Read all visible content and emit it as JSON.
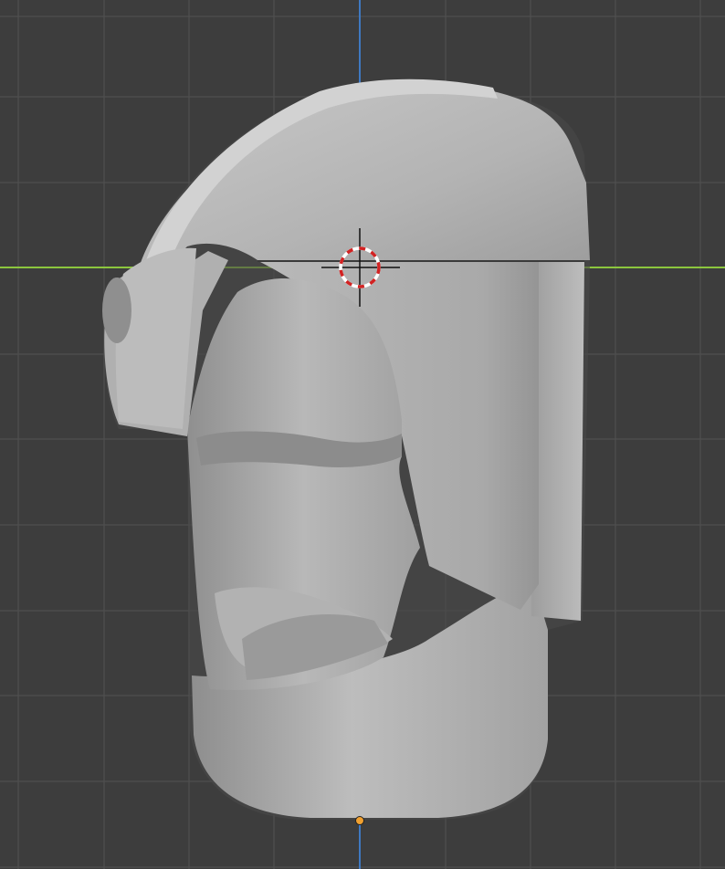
{
  "viewport": {
    "background_color": "#3d3d3d",
    "grid_color": "#4d4d4d",
    "x_axis_color": "#8cc63e",
    "y_axis_color": "#3f79c2",
    "mesh_base_color": "#a7a7a7",
    "mesh_light_color": "#c8c8c8",
    "mesh_shadow_color": "#6f6f6f",
    "cursor_icon": "3d-cursor-icon",
    "cursor_ring_colors": [
      "#ffffff",
      "#d22222"
    ],
    "origin_icon": "object-origin-icon",
    "origin_color": "#f0a030"
  },
  "object": {
    "kind": "sculpted mesh"
  }
}
